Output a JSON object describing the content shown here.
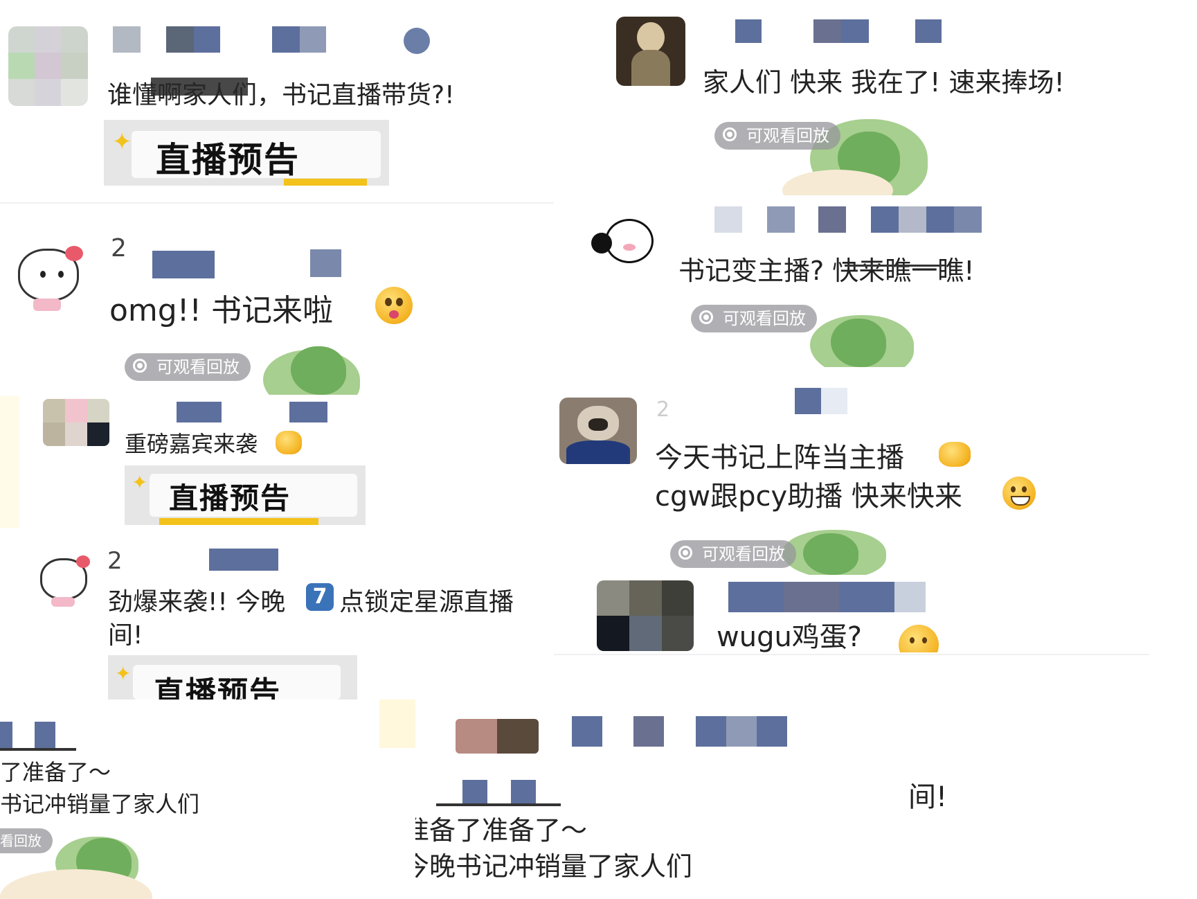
{
  "posts": [
    {
      "id": "p1",
      "text": "谁懂啊家人们，书记直播带货?!",
      "banner": "直播预告"
    },
    {
      "id": "p2",
      "prefix": "2",
      "text": "omg!! 书记来啦",
      "replay": "可观看回放"
    },
    {
      "id": "p3",
      "text": "重磅嘉宾来袭",
      "banner": "直播预告"
    },
    {
      "id": "p4",
      "prefix": "2",
      "text_line1": "劲爆来袭!! 今晚",
      "key": "7",
      "text_line1b": "点锁定星源直播",
      "text_line2": "间!",
      "banner": "直播预告"
    },
    {
      "id": "p5",
      "text_line1": "了准备了～",
      "text_line2": "书记冲销量了家人们",
      "replay": "看回放"
    },
    {
      "id": "p6",
      "text": "家人们 快来 我在了! 速来捧场!",
      "replay": "可观看回放"
    },
    {
      "id": "p7",
      "text": "书记变主播? 快来瞧一瞧!",
      "replay": "可观看回放"
    },
    {
      "id": "p8",
      "prefix": "2",
      "text_line1": "今天书记上阵当主播",
      "text_line2": "cgw跟pcy助播 快来快来",
      "replay": "可观看回放"
    },
    {
      "id": "p9",
      "text": "wugu鸡蛋?"
    },
    {
      "id": "p10",
      "fragment": "间!",
      "text_line1": "准备了准备了～",
      "text_line2": "今晚书记冲销量了家人们"
    }
  ],
  "colors": {
    "accent_block": "#5d6f9c",
    "pill_bg": "#96969b",
    "green": "#6fae5c",
    "banner_yellow": "#f3c21b"
  },
  "icons": [
    "hello-kitty-avatar",
    "dog-avatar",
    "cartoon-girl-avatar",
    "mosaic-avatar",
    "replay-radio-icon",
    "emoji-face"
  ]
}
